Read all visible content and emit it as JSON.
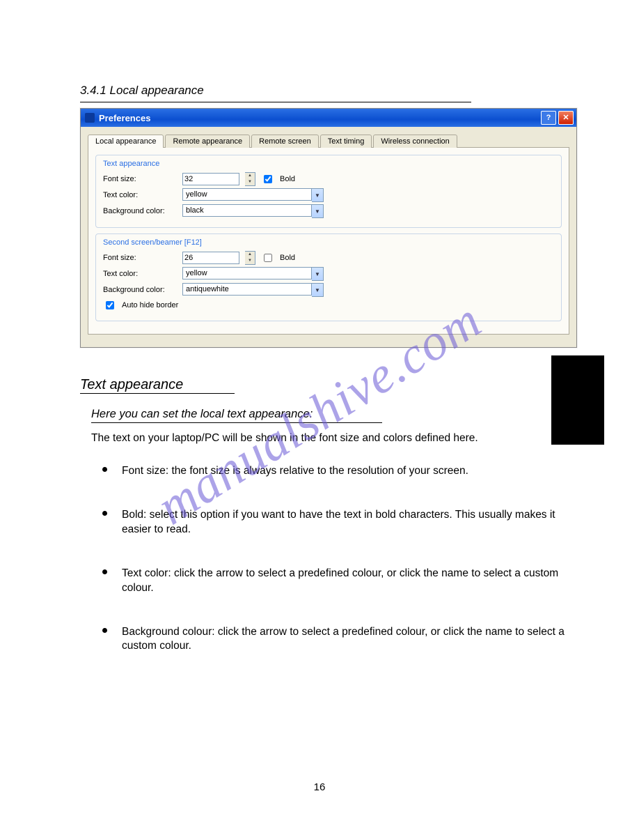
{
  "watermark": "manualshive.com",
  "page_number": "16",
  "black_block_label": "",
  "section": {
    "title": "3.4.1 Local appearance"
  },
  "screenshot": {
    "window_title": "Preferences",
    "help_button": "?",
    "close_button": "✕",
    "tabs": [
      {
        "label": "Local appearance",
        "active": true
      },
      {
        "label": "Remote appearance",
        "active": false
      },
      {
        "label": "Remote screen",
        "active": false
      },
      {
        "label": "Text timing",
        "active": false
      },
      {
        "label": "Wireless connection",
        "active": false
      }
    ],
    "group1": {
      "legend": "Text appearance",
      "font_size_label": "Font size:",
      "font_size_value": "32",
      "bold_label": "Bold",
      "bold_checked": true,
      "text_color_label": "Text color:",
      "text_color_value": "yellow",
      "bg_color_label": "Background color:",
      "bg_color_value": "black"
    },
    "group2": {
      "legend": "Second screen/beamer [F12]",
      "font_size_label": "Font size:",
      "font_size_value": "26",
      "bold_label": "Bold",
      "bold_checked": false,
      "text_color_label": "Text color:",
      "text_color_value": "yellow",
      "bg_color_label": "Background color:",
      "bg_color_value": "antiquewhite",
      "auto_hide_label": "Auto hide border",
      "auto_hide_checked": true
    }
  },
  "body": {
    "heading": "Text appearance",
    "sub_title": "Here you can set the local text appearance:",
    "intro": "The text on your laptop/PC will be shown in the font size and colors defined here.",
    "bullets": [
      "Font size: the font size is always relative to the resolution of your screen.",
      "Bold: select this option if you want to have the text in bold characters. This usually makes it easier to read.",
      "Text color: click the arrow to select a predefined colour, or click the name to select a custom colour.",
      "Background colour: click the arrow to select a predefined colour, or click the name to select a custom colour."
    ]
  }
}
